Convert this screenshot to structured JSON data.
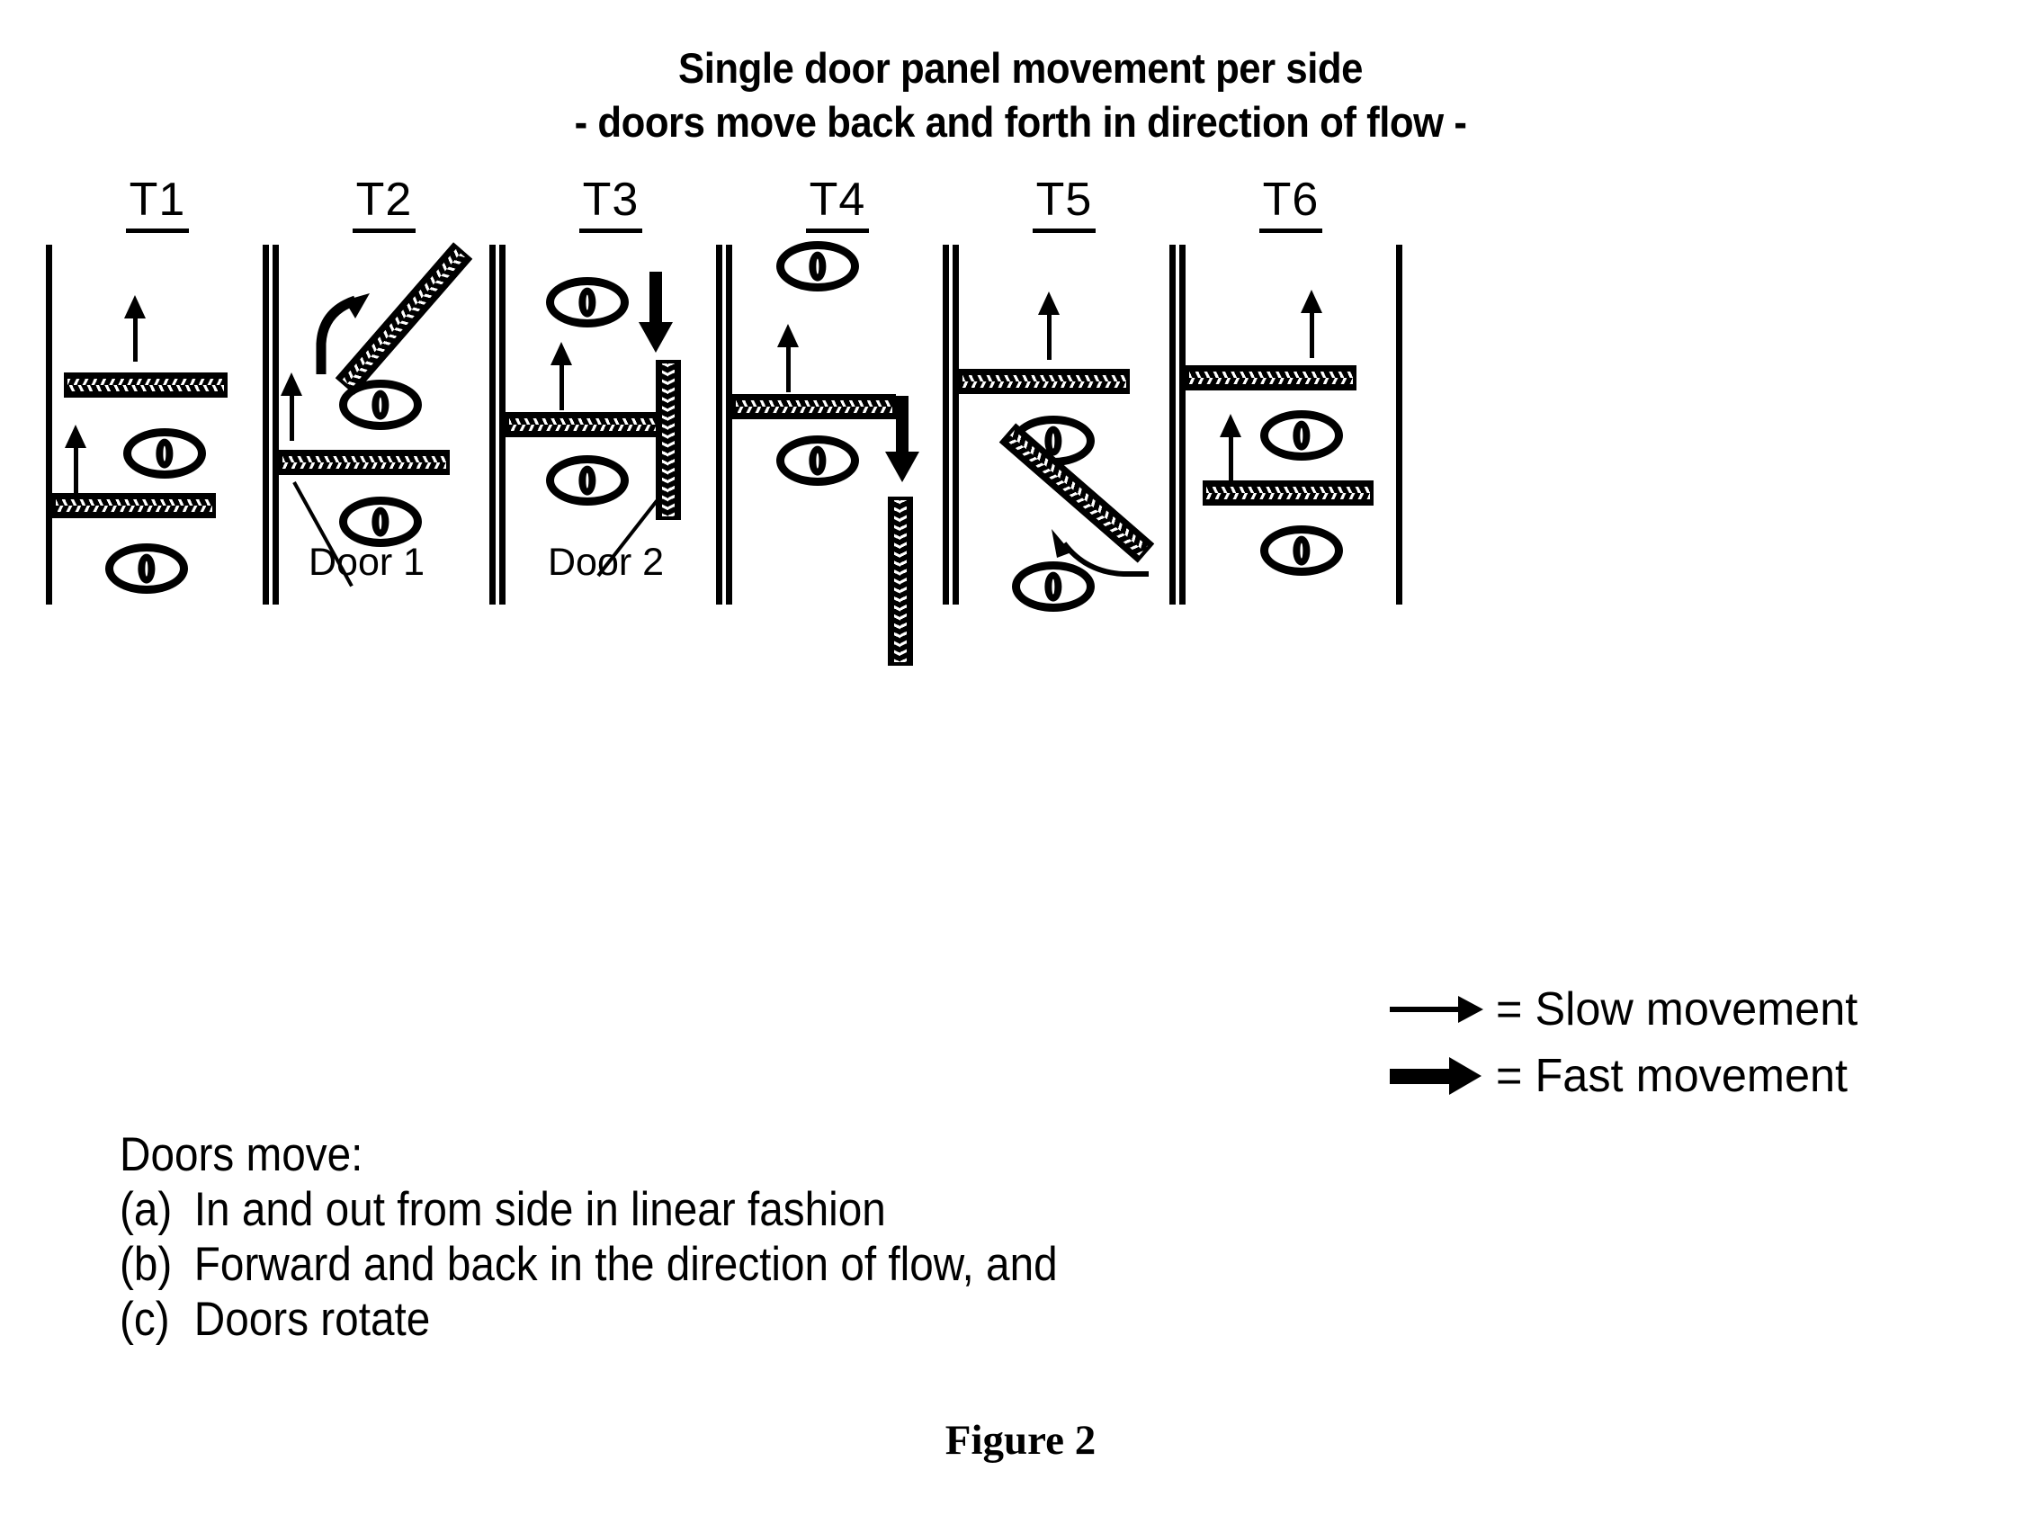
{
  "title": {
    "line1": "Single door panel movement per side",
    "line2": "- doors move back and forth in direction of flow -"
  },
  "panels": [
    {
      "label": "T1"
    },
    {
      "label": "T2"
    },
    {
      "label": "T3"
    },
    {
      "label": "T4"
    },
    {
      "label": "T5"
    },
    {
      "label": "T6"
    }
  ],
  "annotations": {
    "door1": "Door 1",
    "door2": "Door 2"
  },
  "legend": {
    "rows": [
      {
        "icon": "thin-right-arrow-icon",
        "equals": "=",
        "label": "= Slow movement"
      },
      {
        "icon": "thick-right-arrow-icon",
        "equals": "=",
        "label": "= Fast movement"
      }
    ]
  },
  "notes": {
    "heading": "Doors move:",
    "items": [
      {
        "marker": "(a)",
        "text": "In and out from side in linear fashion"
      },
      {
        "marker": "(b)",
        "text": "Forward and back in the direction of flow, and"
      },
      {
        "marker": "(c)",
        "text": "Doors rotate"
      }
    ]
  },
  "caption": "Figure 2",
  "colors": {
    "ink": "#000000",
    "background": "#ffffff"
  }
}
